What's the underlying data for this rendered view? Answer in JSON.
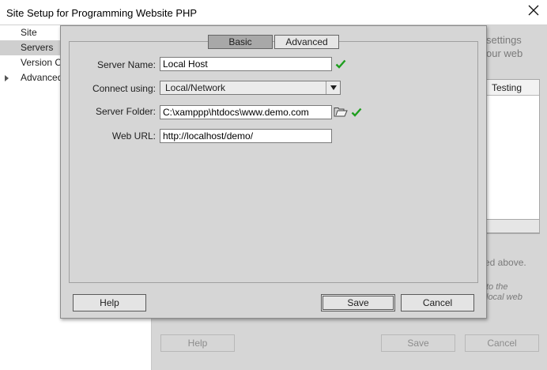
{
  "window": {
    "title": "Site Setup for Programming Website PHP"
  },
  "sidebar": {
    "items": [
      {
        "label": "Site"
      },
      {
        "label": "Servers"
      },
      {
        "label": "Version C"
      },
      {
        "label": "Advanced"
      }
    ]
  },
  "background": {
    "settings_text": "settings",
    "web_text": "our web",
    "table_header": "Testing",
    "note_text": "ed above.",
    "italic_line1": "to the",
    "italic_line2": "local web",
    "help_label": "Help",
    "save_label": "Save",
    "cancel_label": "Cancel"
  },
  "dialog": {
    "tabs": [
      {
        "label": "Basic",
        "active": true
      },
      {
        "label": "Advanced",
        "active": false
      }
    ],
    "fields": {
      "server_name": {
        "label": "Server Name:",
        "value": "Local Host"
      },
      "connect_using": {
        "label": "Connect using:",
        "value": "Local/Network"
      },
      "server_folder": {
        "label": "Server Folder:",
        "value": "C:\\xamppp\\htdocs\\www.demo.com"
      },
      "web_url": {
        "label": "Web URL:",
        "value": "http://localhost/demo/"
      }
    },
    "buttons": {
      "help": "Help",
      "save": "Save",
      "cancel": "Cancel"
    }
  },
  "colors": {
    "valid_check": "#1e9e1e",
    "dialog_bg": "#d6d6d6",
    "active_tab": "#a8a8a8"
  },
  "icons": {
    "close": "close-icon",
    "valid": "checkmark-icon",
    "browse": "folder-icon",
    "dropdown": "chevron-down-icon"
  }
}
